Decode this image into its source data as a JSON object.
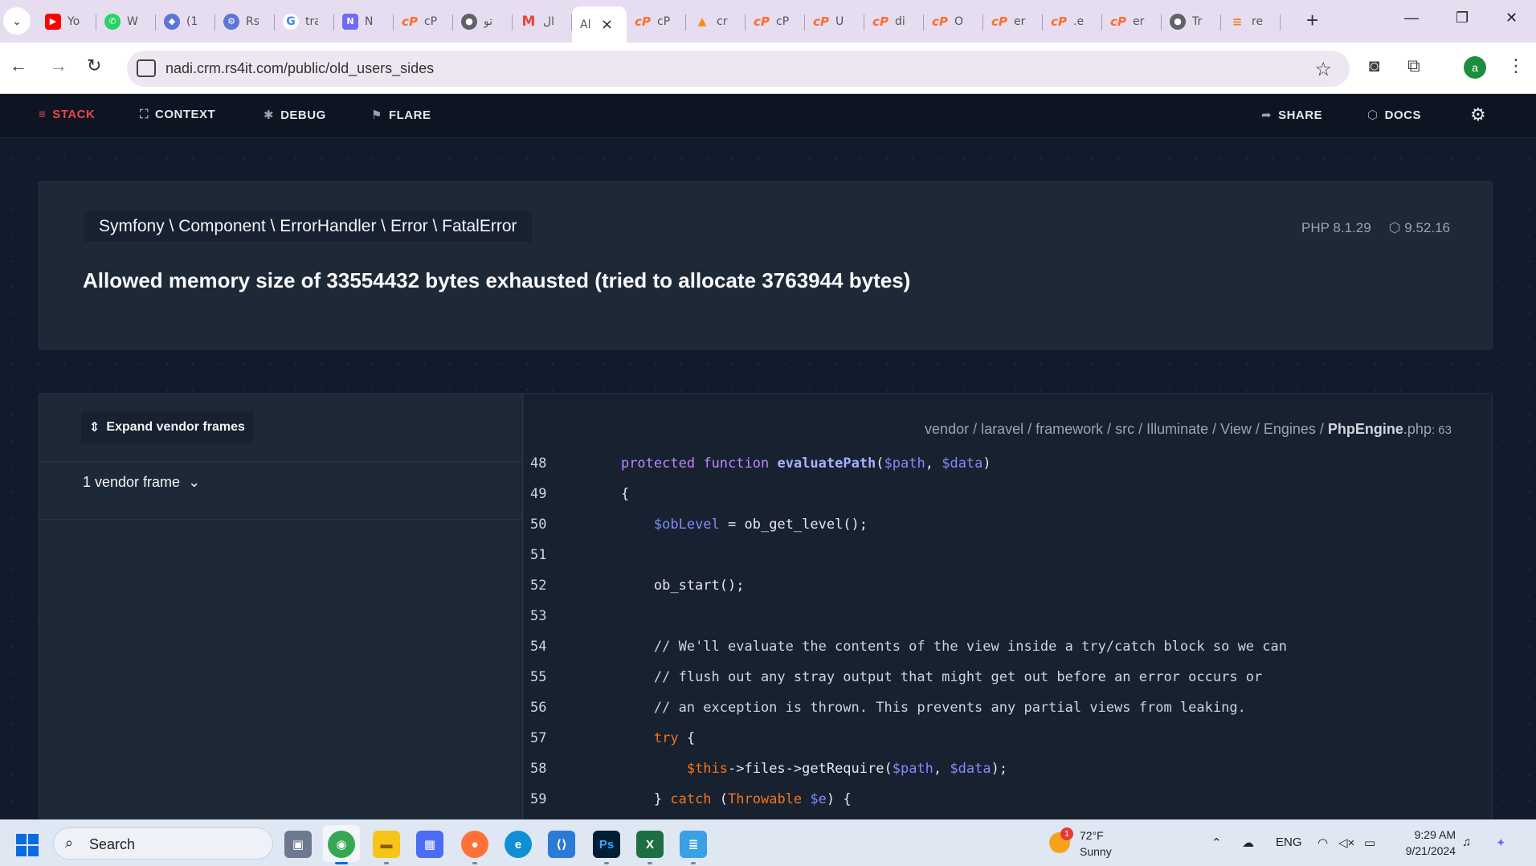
{
  "browser": {
    "tabs": [
      {
        "icon": "youtube-icon",
        "label": "Yo",
        "glyph": "▶",
        "cls": "yt"
      },
      {
        "icon": "whatsapp-icon",
        "label": "W",
        "glyph": "✆",
        "cls": "wa"
      },
      {
        "icon": "feather-icon",
        "label": "(1",
        "glyph": "◆",
        "cls": "pl"
      },
      {
        "icon": "plugin-icon",
        "label": "Rs",
        "glyph": "⚙",
        "cls": "pl"
      },
      {
        "icon": "google-icon",
        "label": "tra",
        "glyph": "G",
        "cls": "go"
      },
      {
        "icon": "notion-icon",
        "label": "N",
        "glyph": "N",
        "cls": "no"
      },
      {
        "icon": "cpanel-icon",
        "label": "cP",
        "glyph": "cP",
        "cls": "cp"
      },
      {
        "icon": "globe-icon",
        "label": "تو",
        "glyph": "●",
        "cls": "gr"
      },
      {
        "icon": "gmail-icon",
        "label": "ال",
        "glyph": "M",
        "cls": "gm"
      },
      {
        "icon": "page-icon",
        "label": "Al",
        "glyph": "",
        "cls": "",
        "active": true
      },
      {
        "icon": "cpanel-icon",
        "label": "cP",
        "glyph": "cP",
        "cls": "cp"
      },
      {
        "icon": "phpmyadmin-icon",
        "label": "cr",
        "glyph": "▲",
        "cls": "pma"
      },
      {
        "icon": "cpanel-icon",
        "label": "cP",
        "glyph": "cP",
        "cls": "cp"
      },
      {
        "icon": "cpanel-icon",
        "label": "U",
        "glyph": "cP",
        "cls": "cp"
      },
      {
        "icon": "cpanel-icon",
        "label": "di",
        "glyph": "cP",
        "cls": "cp"
      },
      {
        "icon": "cpanel-icon",
        "label": "O",
        "glyph": "cP",
        "cls": "cp"
      },
      {
        "icon": "cpanel-icon",
        "label": "er",
        "glyph": "cP",
        "cls": "cp"
      },
      {
        "icon": "cpanel-icon",
        "label": ".e",
        "glyph": "cP",
        "cls": "cp"
      },
      {
        "icon": "cpanel-icon",
        "label": "er",
        "glyph": "cP",
        "cls": "cp"
      },
      {
        "icon": "globe-icon",
        "label": "Tr",
        "glyph": "●",
        "cls": "gr"
      },
      {
        "icon": "stackoverflow-icon",
        "label": "re",
        "glyph": "≡",
        "cls": "so"
      }
    ],
    "url": "nadi.crm.rs4it.com/public/old_users_sides",
    "profile_initial": "a"
  },
  "ignition": {
    "nav": {
      "stack": "STACK",
      "context": "CONTEXT",
      "debug": "DEBUG",
      "flare": "FLARE",
      "share": "SHARE",
      "docs": "DOCS"
    },
    "exception_class": "Symfony \\ Component \\ ErrorHandler \\ Error \\ FatalError",
    "php_version": "PHP 8.1.29",
    "laravel_version": "9.52.16",
    "message": "Allowed memory size of 33554432 bytes exhausted (tried to allocate 3763944 bytes)",
    "expand_vendor": "Expand vendor frames",
    "vendor_frame": "1 vendor frame",
    "file_path": "vendor / laravel / framework / src / Illuminate / View / Engines / ",
    "file_name": "PhpEngine",
    "file_ext": ".php",
    "file_line": ": 63",
    "code": [
      {
        "n": "48",
        "html": "    <span class=\"kw\">protected</span> <span class=\"kw\">function</span> <span class=\"fn\">evaluatePath</span>(<span class=\"var\">$path</span>, <span class=\"var\">$data</span>)"
      },
      {
        "n": "49",
        "html": "    {"
      },
      {
        "n": "50",
        "html": "        <span class=\"var\">$obLevel</span> = ob_get_level();"
      },
      {
        "n": "51",
        "html": ""
      },
      {
        "n": "52",
        "html": "        ob_start();"
      },
      {
        "n": "53",
        "html": ""
      },
      {
        "n": "54",
        "html": "        <span class=\"cm\">// We'll evaluate the contents of the view inside a try/catch block so we can</span>"
      },
      {
        "n": "55",
        "html": "        <span class=\"cm\">// flush out any stray output that might get out before an error occurs or</span>"
      },
      {
        "n": "56",
        "html": "        <span class=\"cm\">// an exception is thrown. This prevents any partial views from leaking.</span>"
      },
      {
        "n": "57",
        "html": "        <span class=\"kw2\">try</span> {"
      },
      {
        "n": "58",
        "html": "            <span class=\"kw2\">$this</span>-&gt;files-&gt;getRequire(<span class=\"var\">$path</span>, <span class=\"var\">$data</span>);"
      },
      {
        "n": "59",
        "html": "        } <span class=\"kw2\">catch</span> (<span class=\"kw2\">Throwable</span> <span class=\"var\">$e</span>) {"
      }
    ]
  },
  "taskbar": {
    "search": "Search",
    "weather_badge": "1",
    "temperature": "72°F",
    "condition": "Sunny",
    "language": "ENG",
    "time": "9:29 AM",
    "date": "9/21/2024"
  },
  "colors": {
    "page_bg": "#121b2b",
    "card_bg": "#1e2938",
    "accent": "#ef4444"
  }
}
